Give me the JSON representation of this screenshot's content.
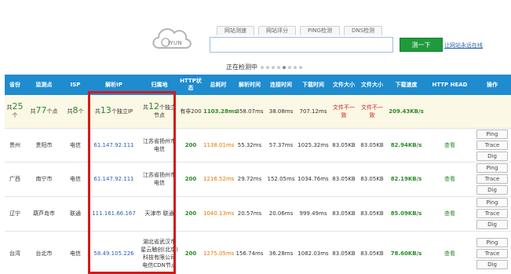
{
  "logo": {
    "text": "IYUN",
    "icon": "cloud-icon"
  },
  "tabs": [
    "网站测速",
    "网站评分",
    "PING检测",
    "DNS检测"
  ],
  "search": {
    "value": "",
    "placeholder": ""
  },
  "test_button": "测一下",
  "promo_link": "让网站永远在线",
  "status": "正在检测中",
  "columns": [
    "省份",
    "监测点",
    "ISP",
    "解析IP",
    "归属地",
    "HTTP状态",
    "总耗时",
    "解析时间",
    "连接时间",
    "下载时间",
    "文件大小",
    "文件大小",
    "下载速度",
    "HTTP HEAD",
    "操作"
  ],
  "summary": {
    "provinces_pre": "共",
    "provinces_num": "25",
    "provinces_post": "个",
    "points_pre": "共",
    "points_num": "77",
    "points_post": "个点",
    "isp_pre": "共",
    "isp_num": "8",
    "isp_post": "个",
    "ip_pre": "共",
    "ip_num": "13",
    "ip_post": "个独立IP",
    "loc_pre": "共",
    "loc_num": "12",
    "loc_post": "个独立节点",
    "http": "有非200",
    "total": "1103.28ms",
    "resolve": "358.07ms",
    "connect": "38.08ms",
    "download": "707.12ms",
    "size1": "文件不一致",
    "size2": "文件不一致",
    "speed": "209.43KB/s"
  },
  "rows": [
    {
      "province": "贵州",
      "point": "贵阳市",
      "isp": "电信",
      "ip": "61.147.92.111",
      "location": "江苏省扬州市 电信",
      "http": "200",
      "total": "1138.01ms",
      "resolve": "55.32ms",
      "connect": "57.37ms",
      "download": "1025.32ms",
      "size1": "83.05KB",
      "size2": "83.05KB",
      "speed": "82.94KB/s",
      "head": "查看",
      "ops": [
        "Ping",
        "Trace",
        "Dig"
      ]
    },
    {
      "province": "广西",
      "point": "南宁市",
      "isp": "电信",
      "ip": "61.147.92.111",
      "location": "江苏省扬州市 电信",
      "http": "200",
      "total": "1216.52ms",
      "resolve": "29.72ms",
      "connect": "152.05ms",
      "download": "1034.76ms",
      "size1": "83.05KB",
      "size2": "83.05KB",
      "speed": "82.19KB/s",
      "head": "查看",
      "ops": [
        "Ping",
        "Trace",
        "Dig"
      ]
    },
    {
      "province": "辽宁",
      "point": "葫芦岛市",
      "isp": "联通",
      "ip": "111.161.66.167",
      "location": "天津市 联通",
      "http": "200",
      "total": "1040.13ms",
      "resolve": "20.57ms",
      "connect": "20.06ms",
      "download": "999.49ms",
      "size1": "83.05KB",
      "size2": "83.05KB",
      "speed": "85.09KB/s",
      "head": "查看",
      "ops": [
        "Ping",
        "Trace",
        "Dig"
      ]
    },
    {
      "province": "台湾",
      "point": "台北市",
      "isp": "电信",
      "ip": "58.49.105.226",
      "location": "湖北省武汉市 星云触创(北京)科技有限公司电信CDN节点",
      "http": "200",
      "total": "1275.05ms",
      "resolve": "156.74ms",
      "connect": "36.28ms",
      "download": "1082.03ms",
      "size1": "83.05KB",
      "size2": "83.05KB",
      "speed": "78.60KB/s",
      "head": "查看",
      "ops": [
        "Ping",
        "Trace",
        "Dig"
      ]
    }
  ],
  "colors": {
    "header_bg": "#1e8ccf",
    "highlight": "#d21b1b",
    "button": "#1f9b3b"
  }
}
